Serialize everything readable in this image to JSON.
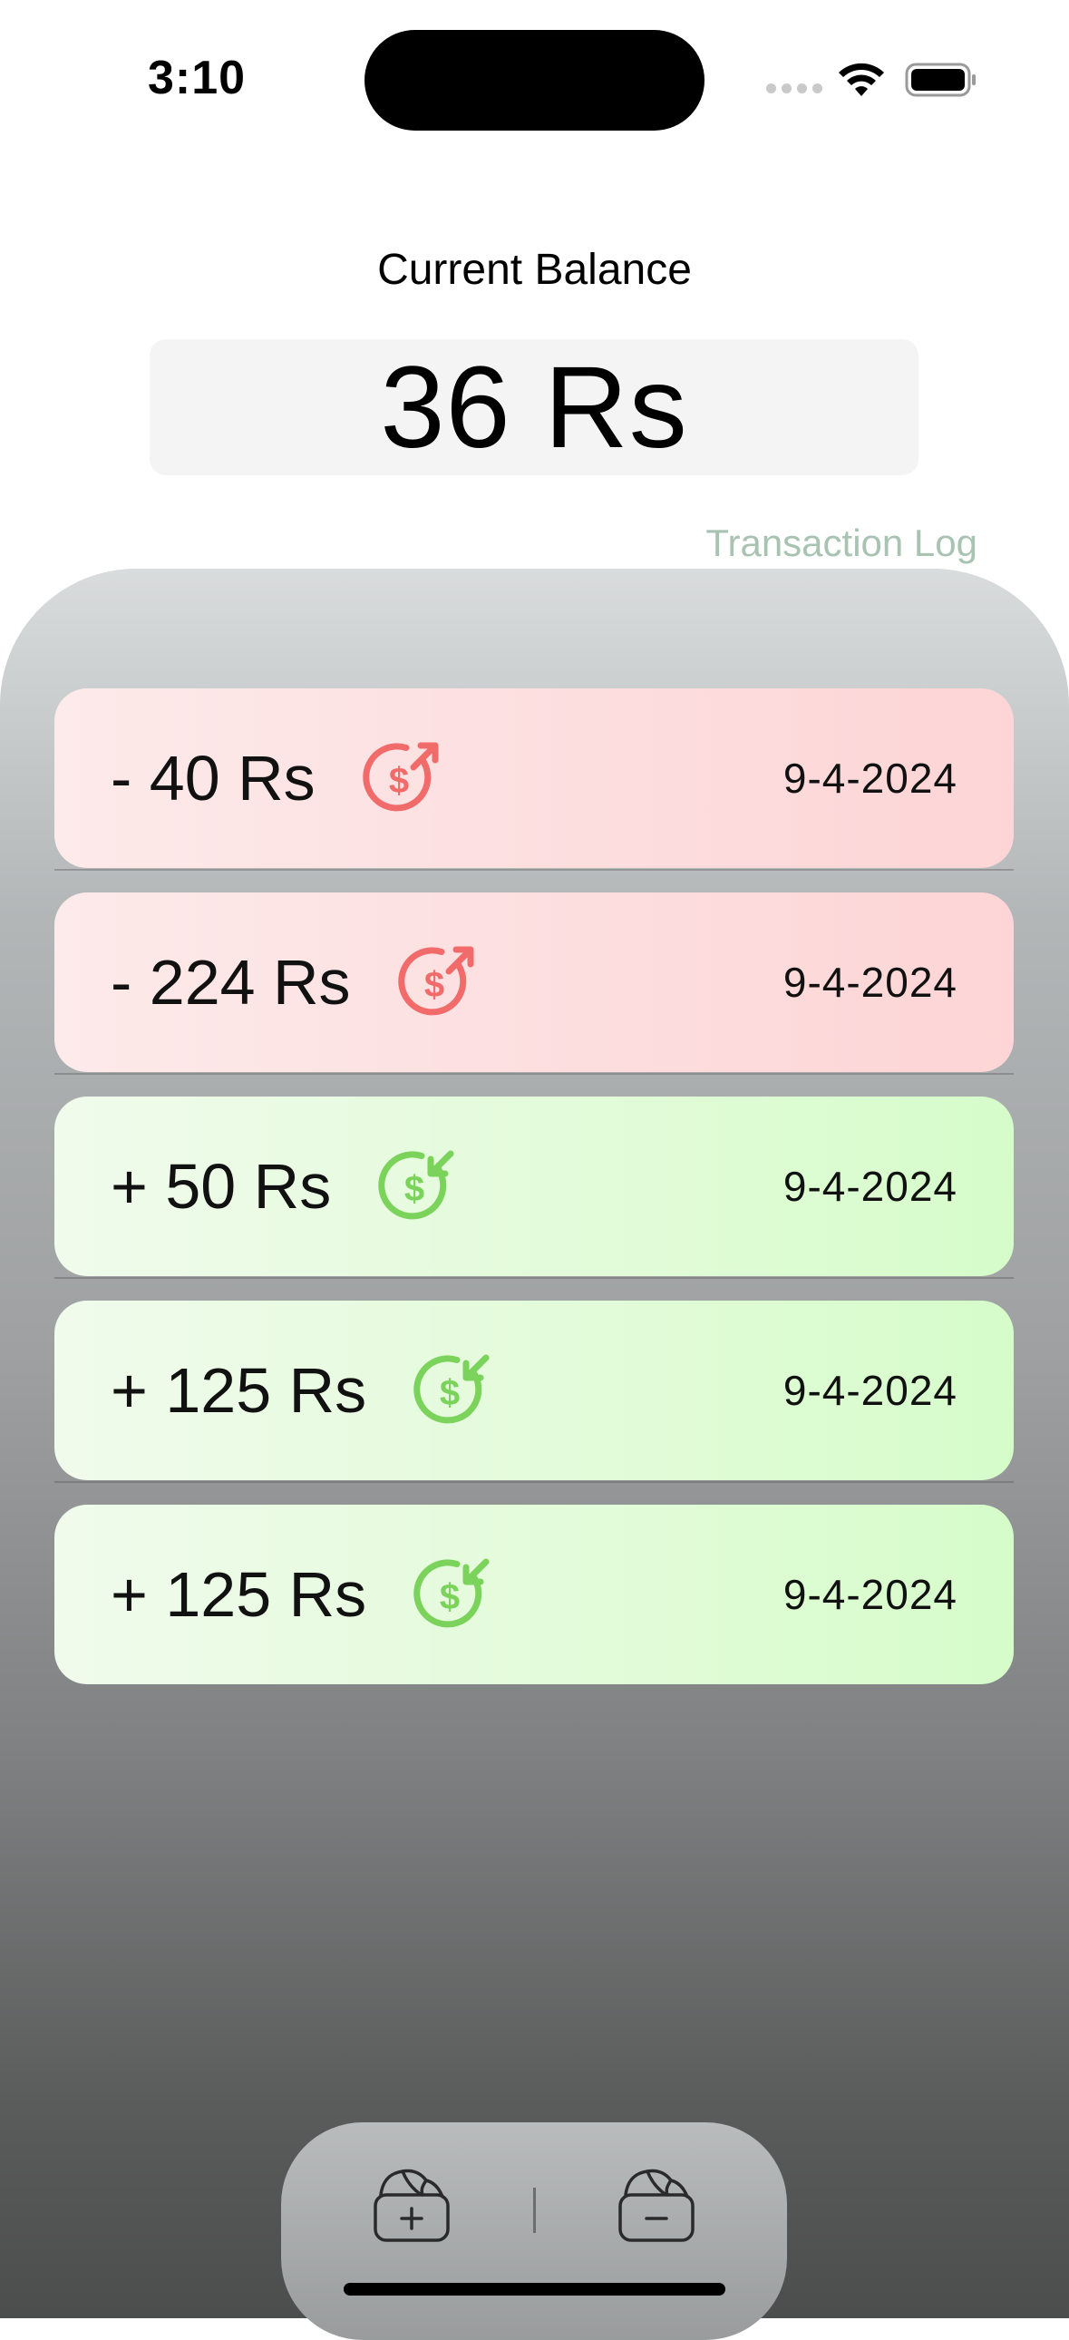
{
  "status_bar": {
    "time": "3:10"
  },
  "balance": {
    "label": "Current Balance",
    "value": "36 Rs"
  },
  "log_link": "Transaction Log",
  "transactions": [
    {
      "amount": "- 40 Rs",
      "date": "9-4-2024",
      "type": "debit",
      "icon": "money-out-icon"
    },
    {
      "amount": "- 224 Rs",
      "date": "9-4-2024",
      "type": "debit",
      "icon": "money-out-icon"
    },
    {
      "amount": "+ 50 Rs",
      "date": "9-4-2024",
      "type": "credit",
      "icon": "money-in-icon"
    },
    {
      "amount": "+ 125 Rs",
      "date": "9-4-2024",
      "type": "credit",
      "icon": "money-in-icon"
    },
    {
      "amount": "+ 125 Rs",
      "date": "9-4-2024",
      "type": "credit",
      "icon": "money-in-icon"
    }
  ],
  "dock": {
    "add_icon": "wallet-add-icon",
    "remove_icon": "wallet-remove-icon"
  },
  "colors": {
    "debit_icon": "#f26b6b",
    "credit_icon": "#7bd35b",
    "log_link": "#a9c3b2"
  }
}
